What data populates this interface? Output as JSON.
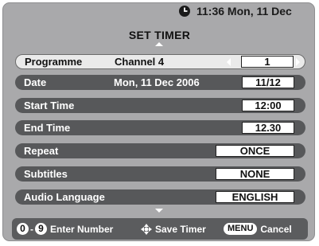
{
  "header": {
    "clock_time": "11:36 Mon, 11 Dec"
  },
  "screen_title": "SET TIMER",
  "rows": [
    {
      "label": "Programme",
      "info": "Channel 4",
      "value": "1",
      "selected": true
    },
    {
      "label": "Date",
      "info": "Mon, 11 Dec 2006",
      "value": "11/12"
    },
    {
      "label": "Start Time",
      "value": "12:00"
    },
    {
      "label": "End Time",
      "value": "12.30"
    },
    {
      "label": "Repeat",
      "value": "ONCE"
    },
    {
      "label": "Subtitles",
      "value": "NONE"
    },
    {
      "label": "Audio Language",
      "value": "ENGLISH"
    }
  ],
  "footer": {
    "key_start": "0",
    "key_separator": "-",
    "key_end": "9",
    "enter_number": "Enter Number",
    "save_timer": "Save Timer",
    "menu_key": "MENU",
    "cancel": "Cancel"
  },
  "colors": {
    "panel_bg": "#a9a9ab",
    "row_bg": "#57585a",
    "selected_row_bg": "#eaeaea",
    "footer_bg": "#5b5c5e"
  },
  "icons": {
    "clock": "clock-icon",
    "ok_navigation": "ok-navigation-icon"
  }
}
